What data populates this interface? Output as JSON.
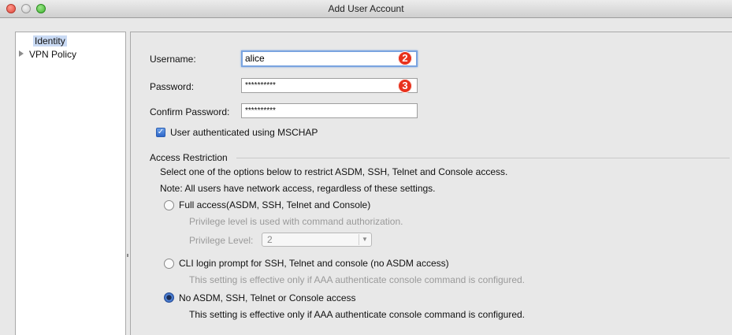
{
  "window": {
    "title": "Add User Account"
  },
  "sidebar": {
    "items": [
      {
        "label": "Identity"
      },
      {
        "label": "VPN Policy"
      }
    ]
  },
  "form": {
    "username_label": "Username:",
    "username_value": "alice",
    "password_label": "Password:",
    "password_value": "**********",
    "confirm_label": "Confirm Password:",
    "confirm_value": "**********",
    "mschap_label": "User authenticated using MSCHAP",
    "mschap_checked": true
  },
  "badges": {
    "username": "2",
    "password": "3"
  },
  "access": {
    "section_title": "Access Restriction",
    "instructions": "Select one of the options below to restrict ASDM, SSH, Telnet and Console access.",
    "note": "Note: All users have network access, regardless of these settings.",
    "options": [
      {
        "label": "Full access(ASDM, SSH, Telnet and Console)",
        "desc": "Privilege level is used with command authorization.",
        "selected": false
      },
      {
        "label": "CLI login prompt for SSH, Telnet and console (no ASDM access)",
        "desc": "This setting is effective only if AAA authenticate console command is configured.",
        "selected": false
      },
      {
        "label": "No ASDM, SSH, Telnet or Console access",
        "desc": "This setting is effective only if AAA authenticate console command is configured.",
        "selected": true
      }
    ],
    "privilege_label": "Privilege Level:",
    "privilege_value": "2"
  },
  "colors": {
    "badge": "#e8321d",
    "selection": "#c9daf4",
    "accent": "#2d66c8"
  }
}
